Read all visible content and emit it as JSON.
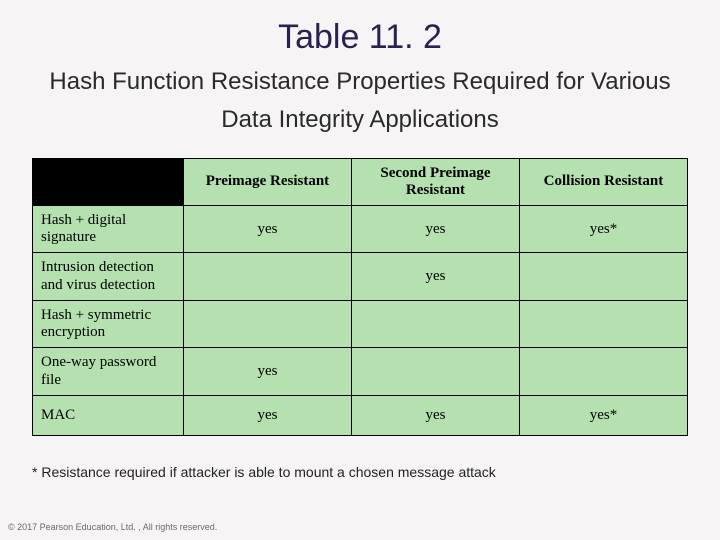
{
  "title": "Table 11. 2",
  "subtitle_l1": "Hash Function Resistance Properties Required for Various",
  "subtitle_l2": "Data Integrity Applications",
  "headers": [
    "Preimage Resistant",
    "Second Preimage Resistant",
    "Collision Resistant"
  ],
  "rows": [
    {
      "label": "Hash + digital signature",
      "c": [
        "yes",
        "yes",
        "yes*"
      ]
    },
    {
      "label": "Intrusion detection and virus detection",
      "c": [
        "",
        "yes",
        ""
      ]
    },
    {
      "label": "Hash + symmetric encryption",
      "c": [
        "",
        "",
        ""
      ]
    },
    {
      "label": "One-way password file",
      "c": [
        "yes",
        "",
        ""
      ]
    },
    {
      "label": "MAC",
      "c": [
        "yes",
        "yes",
        "yes*"
      ]
    }
  ],
  "footnote": "* Resistance required if attacker is able to mount a chosen message attack",
  "copyright": "© 2017 Pearson Education, Ltd. , All rights reserved.",
  "chart_data": {
    "type": "table",
    "title": "Hash Function Resistance Properties Required for Various Data Integrity Applications",
    "columns": [
      "Preimage Resistant",
      "Second Preimage Resistant",
      "Collision Resistant"
    ],
    "rows": [
      {
        "application": "Hash + digital signature",
        "preimage": "yes",
        "second_preimage": "yes",
        "collision": "yes*"
      },
      {
        "application": "Intrusion detection and virus detection",
        "preimage": "",
        "second_preimage": "yes",
        "collision": ""
      },
      {
        "application": "Hash + symmetric encryption",
        "preimage": "",
        "second_preimage": "",
        "collision": ""
      },
      {
        "application": "One-way password file",
        "preimage": "yes",
        "second_preimage": "",
        "collision": ""
      },
      {
        "application": "MAC",
        "preimage": "yes",
        "second_preimage": "yes",
        "collision": "yes*"
      }
    ],
    "footnote": "* Resistance required if attacker is able to mount a chosen message attack"
  }
}
